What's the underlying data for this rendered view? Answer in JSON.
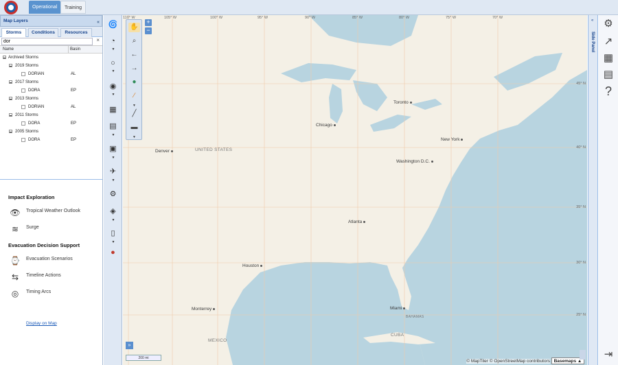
{
  "topbar": {
    "tabs": [
      "Operational",
      "Training"
    ]
  },
  "left_panel": {
    "title": "Map Layers",
    "tabs": [
      "Storms",
      "Conditions",
      "Resources"
    ],
    "search_value": "dor",
    "columns": [
      "Name",
      "Basin"
    ],
    "tree": {
      "root": "Archived Storms",
      "groups": [
        {
          "label": "2019 Storms",
          "storms": [
            {
              "name": "DORIAN",
              "basin": "AL"
            }
          ]
        },
        {
          "label": "2017 Storms",
          "storms": [
            {
              "name": "DORA",
              "basin": "EP"
            }
          ]
        },
        {
          "label": "2013 Storms",
          "storms": [
            {
              "name": "DORIAN",
              "basin": "AL"
            }
          ]
        },
        {
          "label": "2011 Storms",
          "storms": [
            {
              "name": "DORA",
              "basin": "EP"
            }
          ]
        },
        {
          "label": "2005 Storms",
          "storms": [
            {
              "name": "DORA",
              "basin": "EP"
            }
          ]
        }
      ]
    },
    "impact": {
      "title": "Impact Exploration",
      "items": [
        {
          "label": "Tropical Weather Outlook",
          "icon": "binoculars-icon"
        },
        {
          "label": "Surge",
          "icon": "wave-icon"
        }
      ]
    },
    "evac": {
      "title": "Evacuation Decision Support",
      "items": [
        {
          "label": "Evacuation Scenarios",
          "icon": "watch-icon"
        },
        {
          "label": "Timeline Actions",
          "icon": "arrows-icon"
        },
        {
          "label": "Timing Arcs",
          "icon": "target-icon"
        }
      ],
      "link": "Display on Map"
    }
  },
  "map": {
    "cities": [
      "Denver",
      "Chicago",
      "Toronto",
      "New York",
      "Washington D.C.",
      "Atlanta",
      "Houston",
      "Monterrey",
      "Miami"
    ],
    "countries": [
      "UNITED STATES",
      "MEXICO",
      "CUBA",
      "BAHAMAS"
    ],
    "lon_labels": [
      "110° W",
      "105° W",
      "100° W",
      "95° W",
      "90° W",
      "85° W",
      "80° W",
      "75° W",
      "70° W"
    ],
    "lat_labels": [
      "45° N",
      "40° N",
      "35° N",
      "30° N",
      "25° N"
    ],
    "scale": "200 mi",
    "attribution": "© MapTiler © OpenStreetMap contributors",
    "basemaps_button": "Basemaps ▲",
    "colors": {
      "land": "#f4f0e6",
      "water": "#b8d4e0",
      "grid": "#f0c9a8"
    }
  },
  "side_panel": {
    "label": "Side Panel"
  }
}
